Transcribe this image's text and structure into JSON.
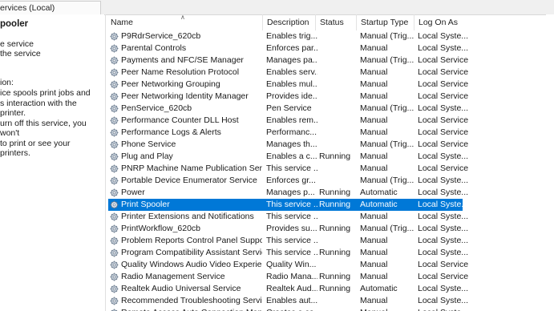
{
  "tab": {
    "title": "ervices (Local)"
  },
  "desc_pane": {
    "service_name": "pooler",
    "link_stop": "e service",
    "link_restart": "the service",
    "heading": "ion:",
    "text_lines": [
      "ice spools print jobs and",
      "s interaction with the printer.",
      "urn off this service, you won't",
      " to print or see your printers."
    ]
  },
  "columns": {
    "name": "Name",
    "description": "Description",
    "status": "Status",
    "startup_type": "Startup Type",
    "log_on_as": "Log On As"
  },
  "rows": [
    {
      "name": "P9RdrService_620cb",
      "description": "Enables trig...",
      "status": "",
      "startup": "Manual (Trig...",
      "logon": "Local Syste..."
    },
    {
      "name": "Parental Controls",
      "description": "Enforces par...",
      "status": "",
      "startup": "Manual",
      "logon": "Local Syste..."
    },
    {
      "name": "Payments and NFC/SE Manager",
      "description": "Manages pa...",
      "status": "",
      "startup": "Manual (Trig...",
      "logon": "Local Service"
    },
    {
      "name": "Peer Name Resolution Protocol",
      "description": "Enables serv...",
      "status": "",
      "startup": "Manual",
      "logon": "Local Service"
    },
    {
      "name": "Peer Networking Grouping",
      "description": "Enables mul...",
      "status": "",
      "startup": "Manual",
      "logon": "Local Service"
    },
    {
      "name": "Peer Networking Identity Manager",
      "description": "Provides ide...",
      "status": "",
      "startup": "Manual",
      "logon": "Local Service"
    },
    {
      "name": "PenService_620cb",
      "description": "Pen Service",
      "status": "",
      "startup": "Manual (Trig...",
      "logon": "Local Syste..."
    },
    {
      "name": "Performance Counter DLL Host",
      "description": "Enables rem...",
      "status": "",
      "startup": "Manual",
      "logon": "Local Service"
    },
    {
      "name": "Performance Logs & Alerts",
      "description": "Performanc...",
      "status": "",
      "startup": "Manual",
      "logon": "Local Service"
    },
    {
      "name": "Phone Service",
      "description": "Manages th...",
      "status": "",
      "startup": "Manual (Trig...",
      "logon": "Local Service"
    },
    {
      "name": "Plug and Play",
      "description": "Enables a c...",
      "status": "Running",
      "startup": "Manual",
      "logon": "Local Syste..."
    },
    {
      "name": "PNRP Machine Name Publication Service",
      "description": "This service ...",
      "status": "",
      "startup": "Manual",
      "logon": "Local Service"
    },
    {
      "name": "Portable Device Enumerator Service",
      "description": "Enforces gr...",
      "status": "",
      "startup": "Manual (Trig...",
      "logon": "Local Syste..."
    },
    {
      "name": "Power",
      "description": "Manages p...",
      "status": "Running",
      "startup": "Automatic",
      "logon": "Local Syste..."
    },
    {
      "name": "Print Spooler",
      "description": "This service ...",
      "status": "Running",
      "startup": "Automatic",
      "logon": "Local Syste...",
      "selected": true
    },
    {
      "name": "Printer Extensions and Notifications",
      "description": "This service ...",
      "status": "",
      "startup": "Manual",
      "logon": "Local Syste..."
    },
    {
      "name": "PrintWorkflow_620cb",
      "description": "Provides su...",
      "status": "Running",
      "startup": "Manual (Trig...",
      "logon": "Local Syste..."
    },
    {
      "name": "Problem Reports Control Panel Support",
      "description": "This service ...",
      "status": "",
      "startup": "Manual",
      "logon": "Local Syste..."
    },
    {
      "name": "Program Compatibility Assistant Service",
      "description": "This service ...",
      "status": "Running",
      "startup": "Manual",
      "logon": "Local Syste..."
    },
    {
      "name": "Quality Windows Audio Video Experience",
      "description": "Quality Win...",
      "status": "",
      "startup": "Manual",
      "logon": "Local Service"
    },
    {
      "name": "Radio Management Service",
      "description": "Radio Mana...",
      "status": "Running",
      "startup": "Manual",
      "logon": "Local Service"
    },
    {
      "name": "Realtek Audio Universal Service",
      "description": "Realtek Aud...",
      "status": "Running",
      "startup": "Automatic",
      "logon": "Local Syste..."
    },
    {
      "name": "Recommended Troubleshooting Service",
      "description": "Enables aut...",
      "status": "",
      "startup": "Manual",
      "logon": "Local Syste..."
    },
    {
      "name": "Remote Access Auto Connection Mana...",
      "description": "Creates a co...",
      "status": "",
      "startup": "Manual",
      "logon": "Local Syste..."
    }
  ],
  "colors": {
    "selection": "#0078d7",
    "selection_text": "#ffffff"
  }
}
